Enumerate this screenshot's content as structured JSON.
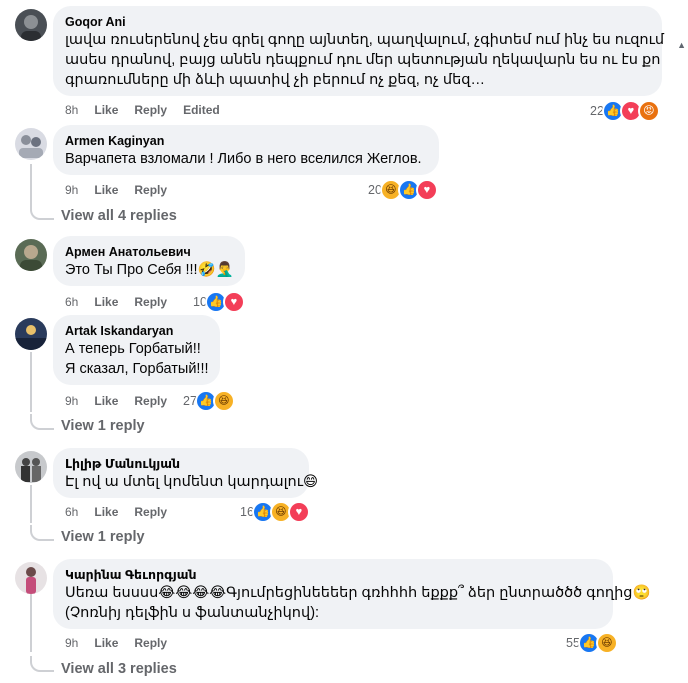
{
  "comments": [
    {
      "author": "Goqor Ani",
      "lines": [
        "լավա ռուսերենով չես գրել գողը այնտեղ, պաղվալում, չգիտեմ ում ինչ ես ուզում",
        "ասես դրանով, բայց անեն դեպքում դու մեր պետության ղեկավարն ես ու էս քո",
        "գրառումները մի ձևի պատիվ չի բերում ոչ քեզ, ոչ մեզ…"
      ],
      "time": "8h",
      "like": "Like",
      "reply": "Reply",
      "edited": "Edited",
      "reaction_count": "22",
      "reactions": [
        "like",
        "love",
        "angry"
      ]
    },
    {
      "author": "Armen Kaginyan",
      "lines": [
        "Варчапета взломали ! Либо в него вселился Жеглов."
      ],
      "time": "9h",
      "like": "Like",
      "reply": "Reply",
      "reaction_count": "20",
      "reactions": [
        "haha",
        "like",
        "love"
      ],
      "view_replies": "View all 4 replies"
    },
    {
      "author": "Армен Анатольевич",
      "lines": [
        "Это Ты Про Себя !!!🤣🤦‍♂️"
      ],
      "time": "6h",
      "like": "Like",
      "reply": "Reply",
      "reaction_count": "10",
      "reactions": [
        "like",
        "love"
      ]
    },
    {
      "author": "Artak Iskandaryan",
      "lines": [
        "А теперь Горбатый!!",
        "Я сказал, Горбатый!!!"
      ],
      "time": "9h",
      "like": "Like",
      "reply": "Reply",
      "reaction_count": "27",
      "reactions": [
        "like",
        "haha"
      ],
      "view_replies": "View 1 reply"
    },
    {
      "author": "Լիլիթ Մանուկյան",
      "lines": [
        "Էլ ով ա մտել կոմենտ կարդալու😄"
      ],
      "time": "6h",
      "like": "Like",
      "reply": "Reply",
      "reaction_count": "16",
      "reactions": [
        "like",
        "haha",
        "love"
      ],
      "view_replies": "View 1 reply"
    },
    {
      "author": "Կարինա Գեւորգյան",
      "lines": [
        "Սեռա եսսսս😂😂😂😂Գյումրեցինեեեեր գռհհհհ եքքք՞ ձեր ընտրածծծ գողից🙄",
        "(Չոռնիյ դելֆին ս ֆանտանչիկով):"
      ],
      "time": "9h",
      "like": "Like",
      "reply": "Reply",
      "reaction_count": "55",
      "reactions": [
        "like",
        "haha"
      ],
      "view_replies": "View all 3 replies"
    }
  ],
  "icons": {
    "like": "👍",
    "love": "♥",
    "haha": "😆",
    "angry": "😡"
  },
  "colors": {
    "bubble": "#f0f2f5",
    "meta": "#65676b",
    "like": "#1877f2",
    "love": "#f33e58",
    "haha": "#f7b125",
    "angry": "#e9710f"
  }
}
